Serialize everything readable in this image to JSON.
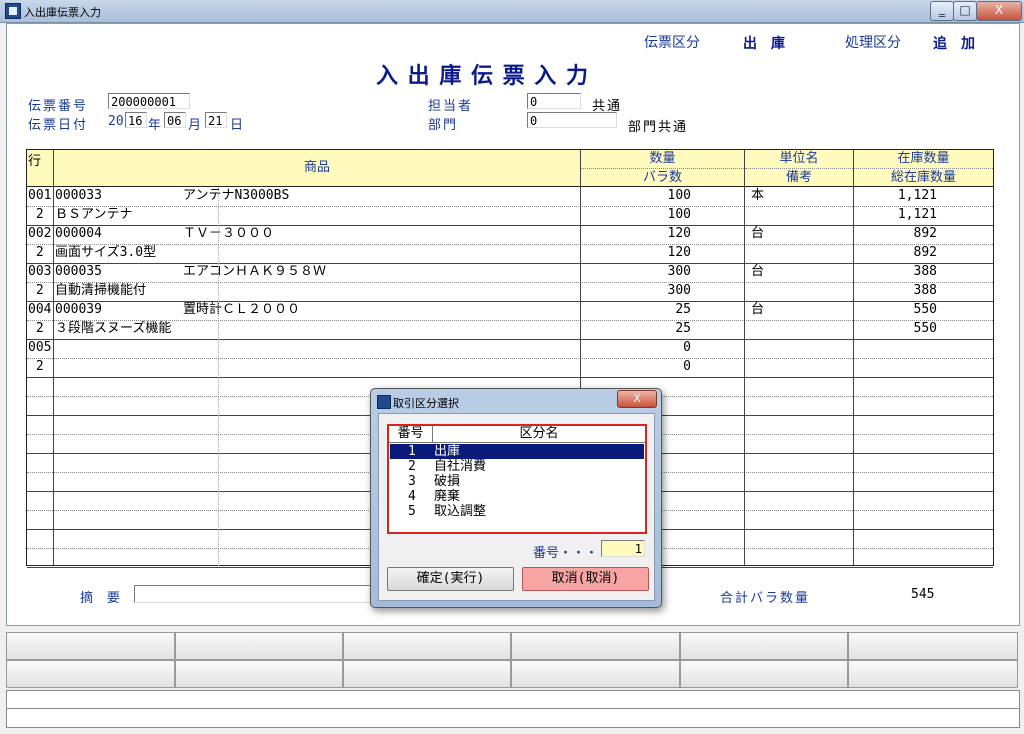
{
  "window": {
    "title": "入出庫伝票入力",
    "minimize": "‗",
    "maximize": "□",
    "close": "X"
  },
  "header": {
    "slip_kind_label": "伝票区分",
    "slip_kind_value": "出　庫",
    "process_kind_label": "処理区分",
    "process_kind_value": "追　加",
    "page_title": "入 出 庫 伝 票 入 力"
  },
  "form": {
    "slip_no_label": "伝票番号",
    "slip_no_value": "200000001",
    "slip_date_label": "伝票日付",
    "date_prefix": "20",
    "date_year": "16",
    "date_year_unit": "年",
    "date_month": "06",
    "date_month_unit": "月",
    "date_day": "21",
    "date_day_unit": "日",
    "person_label": "担当者",
    "person_value": "0",
    "person_name": "共通",
    "dept_label": "部門",
    "dept_value": "0",
    "dept_name": "部門共通"
  },
  "grid": {
    "headers": {
      "line": "行",
      "product": "商品",
      "qty_top": "数量",
      "qty_bottom": "バラ数",
      "unit_top": "単位名",
      "unit_bottom": "備考",
      "stock_top": "在庫数量",
      "stock_bottom": "総在庫数量"
    },
    "rows": [
      {
        "line": "001",
        "code": "000033",
        "name": "アンテナN3000BS",
        "qty": "100",
        "unit": "本",
        "stock": "1,121"
      },
      {
        "line": " 2",
        "code": "",
        "name": "ＢＳアンテナ",
        "qty": "100",
        "unit": "",
        "stock": "1,121"
      },
      {
        "line": "002",
        "code": "000004",
        "name": "ＴＶ－３０００",
        "qty": "120",
        "unit": "台",
        "stock": "892"
      },
      {
        "line": " 2",
        "code": "",
        "name": "画面サイズ3.0型",
        "qty": "120",
        "unit": "",
        "stock": "892"
      },
      {
        "line": "003",
        "code": "000035",
        "name": "エアコンＨＡＫ９５８Ｗ",
        "qty": "300",
        "unit": "台",
        "stock": "388"
      },
      {
        "line": " 2",
        "code": "",
        "name": "自動清掃機能付",
        "qty": "300",
        "unit": "",
        "stock": "388"
      },
      {
        "line": "004",
        "code": "000039",
        "name": "置時計ＣＬ２０００",
        "qty": "25",
        "unit": "台",
        "stock": "550"
      },
      {
        "line": " 2",
        "code": "",
        "name": "３段階スヌーズ機能",
        "qty": "25",
        "unit": "",
        "stock": "550"
      },
      {
        "line": "005",
        "code": "",
        "name": "",
        "qty": "0",
        "unit": "",
        "stock": ""
      },
      {
        "line": " 2",
        "code": "",
        "name": "",
        "qty": "0",
        "unit": "",
        "stock": ""
      }
    ]
  },
  "footer": {
    "memo_label": "摘 要",
    "memo_value": "",
    "total_label": "合計バラ数量",
    "total_value": "545"
  },
  "dialog": {
    "title": "取引区分選択",
    "close": "X",
    "col_no": "番号",
    "col_name": "区分名",
    "items": [
      {
        "no": "1",
        "name": "出庫"
      },
      {
        "no": "2",
        "name": "自社消費"
      },
      {
        "no": "3",
        "name": "破損"
      },
      {
        "no": "4",
        "name": "廃棄"
      },
      {
        "no": "5",
        "name": "取込調整"
      }
    ],
    "number_label": "番号・・・",
    "number_value": "1",
    "ok_label": "確定(実行)",
    "cancel_label": "取消(取消)"
  }
}
